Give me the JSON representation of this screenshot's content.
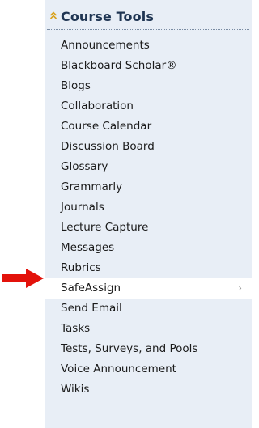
{
  "course_tools": {
    "title": "Course Tools",
    "items": [
      {
        "label": "Announcements"
      },
      {
        "label": "Blackboard Scholar®"
      },
      {
        "label": "Blogs"
      },
      {
        "label": "Collaboration"
      },
      {
        "label": "Course Calendar"
      },
      {
        "label": "Discussion Board"
      },
      {
        "label": "Glossary"
      },
      {
        "label": "Grammarly"
      },
      {
        "label": "Journals"
      },
      {
        "label": "Lecture Capture"
      },
      {
        "label": "Messages"
      },
      {
        "label": "Rubrics"
      },
      {
        "label": "SafeAssign",
        "active": true,
        "has_submenu": true,
        "submenu_indicator": "›"
      },
      {
        "label": "Send Email"
      },
      {
        "label": "Tasks"
      },
      {
        "label": "Tests, Surveys, and Pools"
      },
      {
        "label": "Voice Announcement"
      },
      {
        "label": "Wikis"
      }
    ]
  },
  "colors": {
    "panel_background": "#e8eef6",
    "title_color": "#1f3553",
    "chevron_color": "#d9a21e",
    "arrow_color": "#e3120b",
    "active_background": "#ffffff"
  },
  "icons": {
    "collapse": "chevron-up-double-icon",
    "pointer": "red-arrow-icon"
  }
}
